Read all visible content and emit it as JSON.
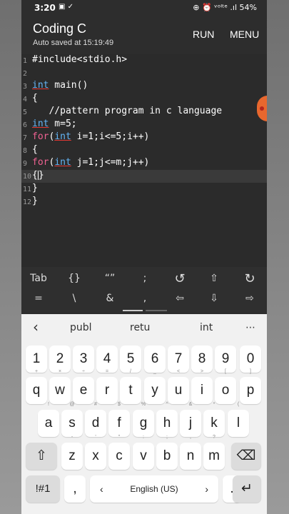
{
  "status": {
    "time": "3:20",
    "battery": "54%",
    "icons_left": "▣ ✓",
    "icons_right": "⊕ ⏰ ᵛᵒˡᵗᵉ .ıl"
  },
  "app": {
    "title": "Coding C",
    "subtitle": "Auto saved at 15:19:49",
    "run": "RUN",
    "menu": "MENU"
  },
  "code_lines": [
    {
      "n": "1",
      "text": "#include<stdio.h>"
    },
    {
      "n": "2",
      "text": ""
    },
    {
      "n": "3",
      "text": "int main()"
    },
    {
      "n": "4",
      "text": "{"
    },
    {
      "n": "5",
      "text": "   //pattern program in c language"
    },
    {
      "n": "6",
      "text": "int m=5;"
    },
    {
      "n": "7",
      "text": "for(int i=1;i<=5;i++)"
    },
    {
      "n": "8",
      "text": "{"
    },
    {
      "n": "9",
      "text": "for(int j=1;j<=m;j++)"
    },
    {
      "n": "10",
      "text": "{}"
    },
    {
      "n": "11",
      "text": "}"
    },
    {
      "n": "12",
      "text": "}"
    }
  ],
  "symbols_row1": [
    "Tab",
    "{}",
    "“”",
    ";",
    "↺",
    "⇧",
    "↻"
  ],
  "symbols_row2": [
    "=",
    "\\",
    "&",
    ",",
    "⇦",
    "⇩",
    "⇨"
  ],
  "suggestions": {
    "back": "‹",
    "items": [
      "publ",
      "retu",
      "int"
    ],
    "more": "⋯"
  },
  "keys": {
    "numbers": [
      "1",
      "2",
      "3",
      "4",
      "5",
      "6",
      "7",
      "8",
      "9",
      "0"
    ],
    "row1": [
      "q",
      "w",
      "e",
      "r",
      "t",
      "y",
      "u",
      "i",
      "o",
      "p"
    ],
    "row1_hints": [
      "+",
      "×",
      "÷",
      "=",
      "/",
      "_",
      "<",
      ">",
      "[",
      "]"
    ],
    "row2": [
      "a",
      "s",
      "d",
      "f",
      "g",
      "h",
      "j",
      "k",
      "l"
    ],
    "row2_hints": [
      "!",
      "@",
      "#",
      "$",
      "%",
      "^",
      "&",
      "*",
      "("
    ],
    "row3": [
      "z",
      "x",
      "c",
      "v",
      "b",
      "n",
      "m"
    ],
    "row3_hints": [
      "-",
      "'",
      "\"",
      ":",
      ";",
      ",",
      "?"
    ],
    "shift": "⇧",
    "backspace": "⌫",
    "sym": "!#1",
    "comma": ",",
    "space": "English (US)",
    "space_left": "‹",
    "space_right": "›",
    "period": ".",
    "enter": "↵"
  }
}
